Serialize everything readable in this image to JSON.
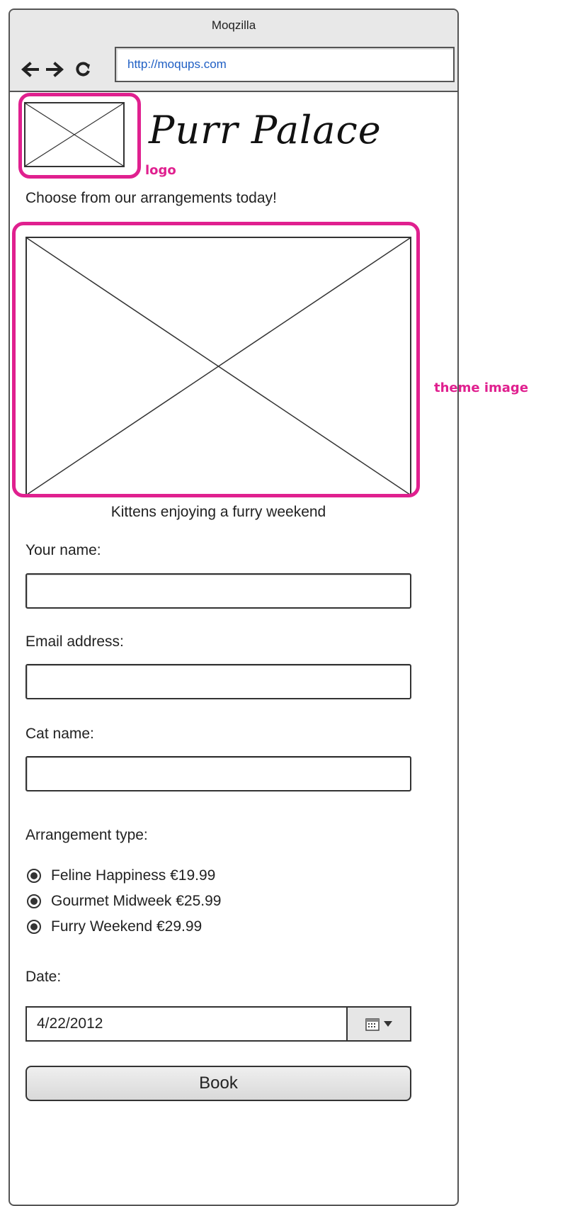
{
  "browser": {
    "title": "Moqzilla",
    "url": "http://moqups.com"
  },
  "page": {
    "brand": "Purr Palace",
    "tagline": "Choose from our arrangements today!",
    "caption": "Kittens enjoying a furry weekend"
  },
  "annotations": {
    "logo_label": "logo",
    "theme_label": "theme image",
    "color": "#e0208f"
  },
  "form": {
    "name_label": "Your name:",
    "email_label": "Email address:",
    "cat_label": "Cat name:",
    "arrangement_label": "Arrangement type:",
    "options": [
      {
        "label": "Feline Happiness €19.99"
      },
      {
        "label": "Gourmet Midweek €25.99"
      },
      {
        "label": "Furry Weekend €29.99"
      }
    ],
    "date_label": "Date:",
    "date_value": "4/22/2012",
    "book_label": "Book"
  },
  "icons": {
    "back": "arrow-left-icon",
    "forward": "arrow-right-icon",
    "reload": "reload-icon",
    "calendar": "calendar-icon",
    "dropdown": "caret-down-icon"
  }
}
